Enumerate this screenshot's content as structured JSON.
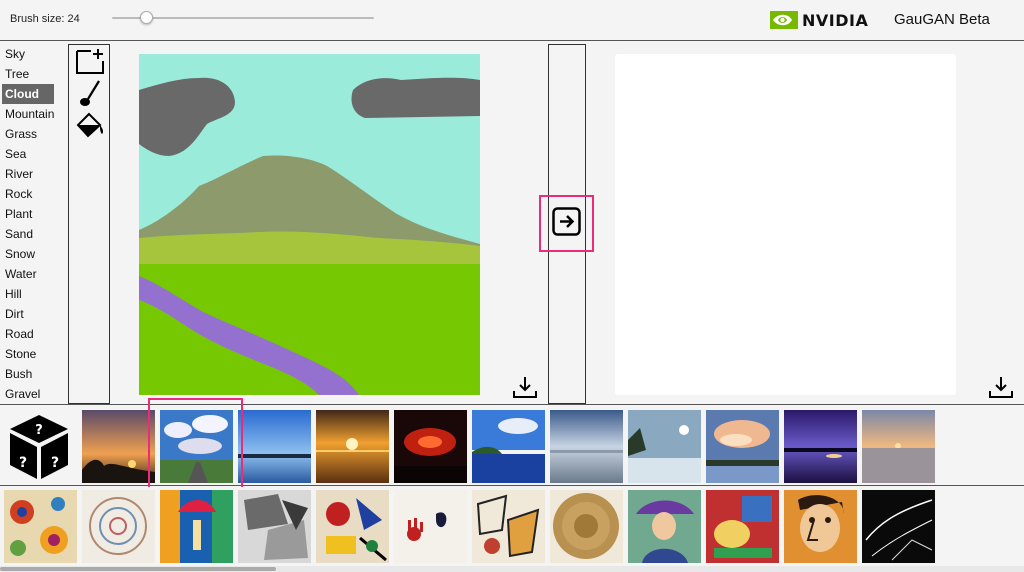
{
  "header": {
    "brush_label": "Brush size: 24",
    "brush_size_fraction": 0.13,
    "nvidia_wordmark": "NVIDIA",
    "app_title": "GauGAN Beta",
    "accent_color": "#76b900"
  },
  "labels": {
    "items": [
      "Sky",
      "Tree",
      "Cloud",
      "Mountain",
      "Grass",
      "Sea",
      "River",
      "Rock",
      "Plant",
      "Sand",
      "Snow",
      "Water",
      "Hill",
      "Dirt",
      "Road",
      "Stone",
      "Bush",
      "Gravel"
    ],
    "selected": "Cloud"
  },
  "tools": [
    "new-canvas-icon",
    "brush-icon",
    "paint-bucket-icon"
  ],
  "segmentation_colors": {
    "sky": "#9bebdb",
    "cloud": "#696969",
    "mountain": "#8c9a6c",
    "hill": "#a7c53c",
    "grass": "#76c803",
    "river": "#9470cf"
  },
  "highlight_color": "#ee2a7b",
  "style_thumbnails_row1": [
    "random-style-dice",
    "sunset-tree",
    "clouds-road",
    "seaside-sky",
    "orange-sunset-sea",
    "red-sky",
    "blue-coast",
    "grey-beach",
    "frosty-shore",
    "pink-clouds-lake",
    "dusk-lake",
    "beach-sunset"
  ],
  "style_thumbnails_row2": [
    "colorful-flowers",
    "swirl-drawing",
    "umbrella-painting",
    "cubist-grey",
    "kandinsky-abstract",
    "hand-print",
    "abstract-sketch",
    "golden-disc",
    "woman-hat",
    "matisse-interior",
    "picasso-portrait",
    "black-lines"
  ]
}
